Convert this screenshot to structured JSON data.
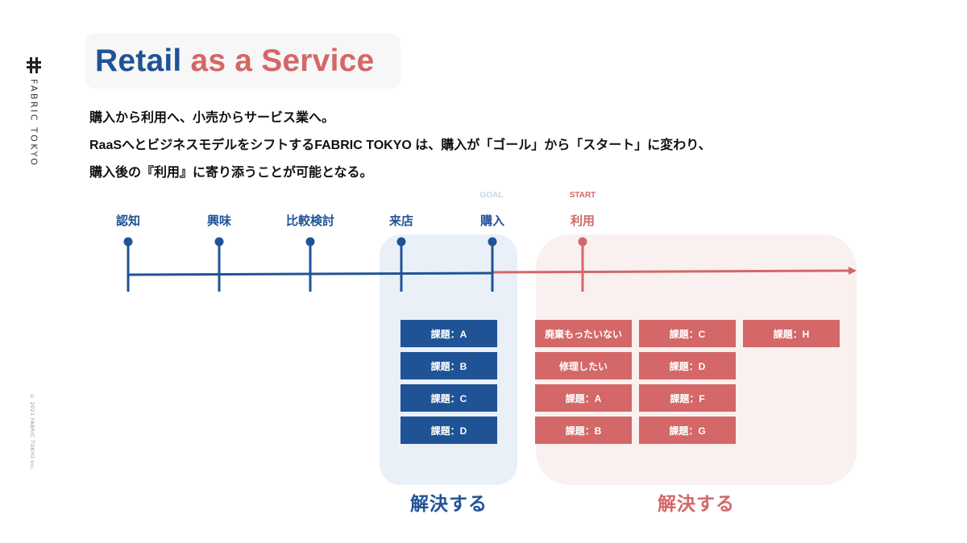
{
  "brand": {
    "name": "FABRIC TOKYO",
    "icon": "hash-logo-icon",
    "copyright": "© 2021 FABRIC TOKYO Inc."
  },
  "colors": {
    "blue": "#1f5396",
    "red": "#d46767",
    "blue_zone": "#e9f0f8",
    "red_zone": "#faf0f0"
  },
  "title": {
    "part1": "Retail",
    "part2": "as a Service"
  },
  "intro": {
    "lines": [
      "購入から利用へ、小売からサービス業へ。",
      "RaaSへとビジネスモデルをシフトするFABRIC TOKYO は、購入が「ゴール」から「スタート」に変わり、",
      "購入後の『利用』に寄り添うことが可能となる。"
    ]
  },
  "timeline": {
    "stages": [
      {
        "label": "認知",
        "tag": ""
      },
      {
        "label": "興味",
        "tag": ""
      },
      {
        "label": "比較検討",
        "tag": ""
      },
      {
        "label": "来店",
        "tag": ""
      },
      {
        "label": "購入",
        "tag": "GOAL"
      },
      {
        "label": "利用",
        "tag": "START"
      }
    ]
  },
  "before_purchase": {
    "tasks": [
      "課題：A",
      "課題：B",
      "課題：C",
      "課題：D"
    ],
    "footer": "解決する"
  },
  "after_purchase": {
    "columns": [
      [
        "廃棄もったいない",
        "修理したい",
        "課題：A",
        "課題：B"
      ],
      [
        "課題：C",
        "課題：D",
        "課題：F",
        "課題：G"
      ],
      [
        "課題：H"
      ]
    ],
    "footer": "解決する"
  }
}
